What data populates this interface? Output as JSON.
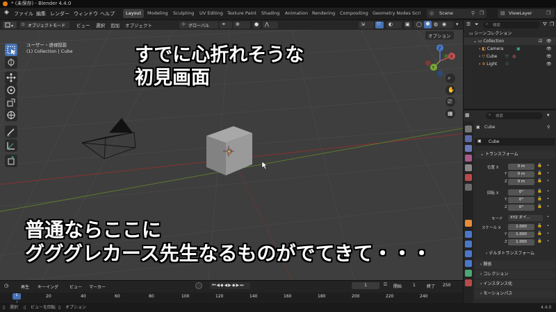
{
  "window": {
    "title": "* (未保存) - Blender 4.4.0"
  },
  "menu": [
    "ファイル",
    "編集",
    "レンダー",
    "ウィンドウ",
    "ヘルプ"
  ],
  "workspaces": [
    "Layout",
    "Modeling",
    "Sculpting",
    "UV Editing",
    "Texture Paint",
    "Shading",
    "Animation",
    "Rendering",
    "Compositing",
    "Geometry Nodes",
    "Scri"
  ],
  "scene": {
    "name": "Scene",
    "view_layer": "ViewLayer"
  },
  "header": {
    "mode": "オブジェクトモード",
    "menus": [
      "ビュー",
      "選択",
      "追加",
      "オブジェクト"
    ],
    "transform": "グローバル",
    "options": "オプション"
  },
  "viewport": {
    "view_name": "ユーザー・透視投影",
    "collection_info": "(1) Collection | Cube",
    "gizmo": {
      "x": "X",
      "y": "Y",
      "z": "Z"
    }
  },
  "overlay": {
    "top_line1": "すでに心折れそうな",
    "top_line2": "初見画面",
    "bottom_line1": "普通ならここに",
    "bottom_line2": "グググレカース先生なるものがでてきて・・・"
  },
  "outliner": {
    "search_placeholder": "検索",
    "root": "シーンコレクション",
    "items": [
      "Collection",
      "Camera",
      "Cube",
      "Light"
    ]
  },
  "properties": {
    "search_placeholder": "検索",
    "object_name": "Cube",
    "object_field": "Cube",
    "transform_section": "トランスフォーム",
    "location_label": "位置 X",
    "rotation_label": "回転 X",
    "scale_label": "スケール X",
    "axis_y": "Y",
    "axis_z": "Z",
    "location": [
      "0 m",
      "0 m",
      "0 m"
    ],
    "rotation": [
      "0°",
      "0°",
      "0°"
    ],
    "scale": [
      "1.000",
      "1.000",
      "1.000"
    ],
    "mode_label": "モード",
    "mode_value": "XYZ オイ...",
    "sections": [
      "デルタトランスフォーム",
      "関係",
      "コレクション",
      "インスタンス化",
      "モーションパス"
    ]
  },
  "timeline": {
    "menus": [
      "再生",
      "キーイング",
      "ビュー",
      "マーカー"
    ],
    "current_frame": "1",
    "start_label": "開始",
    "start": "1",
    "end_label": "終了",
    "end": "250",
    "ticks": [
      "1",
      "20",
      "40",
      "60",
      "80",
      "100",
      "120",
      "140",
      "160",
      "180",
      "200",
      "220",
      "240"
    ]
  },
  "statusbar": {
    "items": [
      "選択",
      "ビューを回転",
      "オプション"
    ],
    "version": "4.4.0"
  },
  "colors": {
    "accent": "#4772b3",
    "blender_orange": "#e87d0d",
    "x_axis": "#b83a3a",
    "y_axis": "#6a9a2a"
  }
}
